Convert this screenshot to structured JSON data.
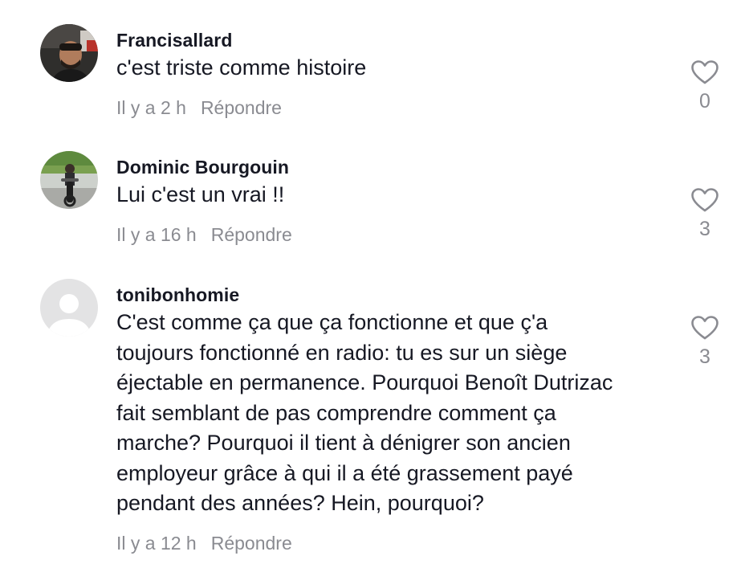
{
  "comments": [
    {
      "username": "Francisallard",
      "text": "c'est triste comme histoire",
      "time": "Il y a 2 h",
      "reply": "Répondre",
      "likes": "0",
      "avatar": "photo-man-in-car"
    },
    {
      "username": "Dominic Bourgouin",
      "text": "Lui c'est un vrai !!",
      "time": "Il y a 16 h",
      "reply": "Répondre",
      "likes": "3",
      "avatar": "photo-motorcycle"
    },
    {
      "username": "tonibonhomie",
      "text_lines": [
        "C'est comme ça que ça fonctionne et que ç'a",
        "toujours fonctionné en radio: tu es sur un siège",
        "éjectable en permanence. Pourquoi Benoît Dutrizac",
        "fait semblant de pas comprendre comment ça",
        "marche? Pourquoi il tient à dénigrer son ancien",
        "employeur grâce à qui il a été grassement payé",
        "pendant des années? Hein, pourquoi?"
      ],
      "time": "Il y a 12 h",
      "reply": "Répondre",
      "likes": "3",
      "avatar": "default-avatar"
    }
  ],
  "colors": {
    "text": "#161823",
    "muted": "#8a8b91",
    "heart": "#8a8b91",
    "default_avatar_bg": "#e3e3e4"
  },
  "icons": {
    "like": "heart-outline-icon"
  }
}
